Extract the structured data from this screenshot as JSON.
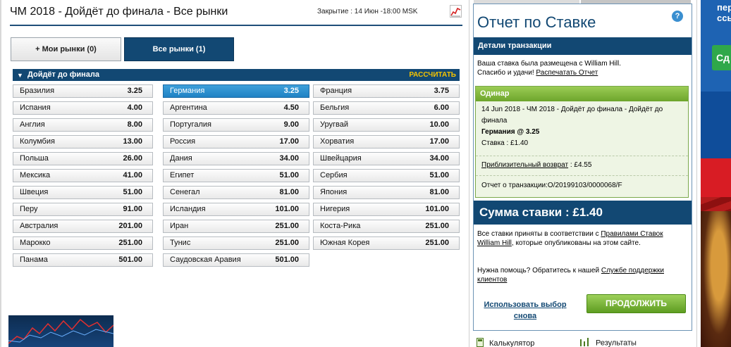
{
  "market": {
    "title": "ЧМ 2018 - Дойдёт до финала - Все рынки",
    "closing": "Закрытие : 14 Июн -18:00 MSK"
  },
  "tabs": {
    "my_markets": "+ Мои рынки (0)",
    "all_markets": "Все рынки (1)"
  },
  "group": {
    "title": "Дойдёт до финала",
    "calc_label": "РАССЧИТАТЬ",
    "columns": [
      [
        {
          "name": "Бразилия",
          "odds": "3.25"
        },
        {
          "name": "Испания",
          "odds": "4.00"
        },
        {
          "name": "Англия",
          "odds": "8.00"
        },
        {
          "name": "Колумбия",
          "odds": "13.00"
        },
        {
          "name": "Польша",
          "odds": "26.00"
        },
        {
          "name": "Мексика",
          "odds": "41.00"
        },
        {
          "name": "Швеция",
          "odds": "51.00"
        },
        {
          "name": "Перу",
          "odds": "91.00"
        },
        {
          "name": "Австралия",
          "odds": "201.00"
        },
        {
          "name": "Марокко",
          "odds": "251.00"
        },
        {
          "name": "Панама",
          "odds": "501.00"
        }
      ],
      [
        {
          "name": "Германия",
          "odds": "3.25",
          "selected": true
        },
        {
          "name": "Аргентина",
          "odds": "4.50"
        },
        {
          "name": "Португалия",
          "odds": "9.00"
        },
        {
          "name": "Россия",
          "odds": "17.00"
        },
        {
          "name": "Дания",
          "odds": "34.00"
        },
        {
          "name": "Египет",
          "odds": "51.00"
        },
        {
          "name": "Сенегал",
          "odds": "81.00"
        },
        {
          "name": "Исландия",
          "odds": "101.00"
        },
        {
          "name": "Иран",
          "odds": "251.00"
        },
        {
          "name": "Тунис",
          "odds": "251.00"
        },
        {
          "name": "Саудовская Аравия",
          "odds": "501.00"
        }
      ],
      [
        {
          "name": "Франция",
          "odds": "3.75"
        },
        {
          "name": "Бельгия",
          "odds": "6.00"
        },
        {
          "name": "Уругвай",
          "odds": "10.00"
        },
        {
          "name": "Хорватия",
          "odds": "17.00"
        },
        {
          "name": "Швейцария",
          "odds": "34.00"
        },
        {
          "name": "Сербия",
          "odds": "51.00"
        },
        {
          "name": "Япония",
          "odds": "81.00"
        },
        {
          "name": "Нигерия",
          "odds": "101.00"
        },
        {
          "name": "Коста-Рика",
          "odds": "251.00"
        },
        {
          "name": "Южная Корея",
          "odds": "251.00"
        }
      ]
    ]
  },
  "receipt": {
    "title": "Отчет по Ставке",
    "help_icon": "?",
    "details_header": "Детали транзакции",
    "placed_line": "Ваша ставка была размещена с William Hill.",
    "luck_text": "Спасибо и удачи!",
    "print_link": "Распечатать Отчет",
    "single": {
      "header": "Одинар",
      "event": "14 Jun 2018 - ЧМ 2018 - Дойдёт до финала - Дойдёт до финала",
      "selection": "Германия @ 3.25",
      "stake_line": "Ставка : £1.40",
      "approx_label": "Приблизительный возврат",
      "approx_value": ": £4.55",
      "txn_ref": "Отчет о транзакции:O/20199103/0000068/F"
    },
    "stake_total": "Сумма ставки : £1.40",
    "accepted_prefix": "Все ставки приняты в соответствии с ",
    "rules_link": "Правилами Ставок William Hill",
    "accepted_suffix": ", которые опубликованы на этом сайте.",
    "help_prefix": "Нужна помощь? Обратитесь к нашей ",
    "support_link": "Службе поддержки клиентов",
    "reuse_link": "Использовать выбор снова",
    "continue_button": "ПРОДОЛЖИТЬ"
  },
  "footer": {
    "calculator": "Калькулятор",
    "results": "Результаты"
  },
  "ad": {
    "text_line1": "пер",
    "text_line2": "ссы",
    "button_text": "Сд"
  },
  "colors": {
    "brand_navy": "#124873",
    "odds_selected": "#2a8fd0",
    "green_button": "#6da52c",
    "calc_yellow": "#f5c400"
  },
  "icons": [
    "chart-icon",
    "help-icon",
    "calculator-icon",
    "results-icon",
    "triangle-down-icon"
  ]
}
